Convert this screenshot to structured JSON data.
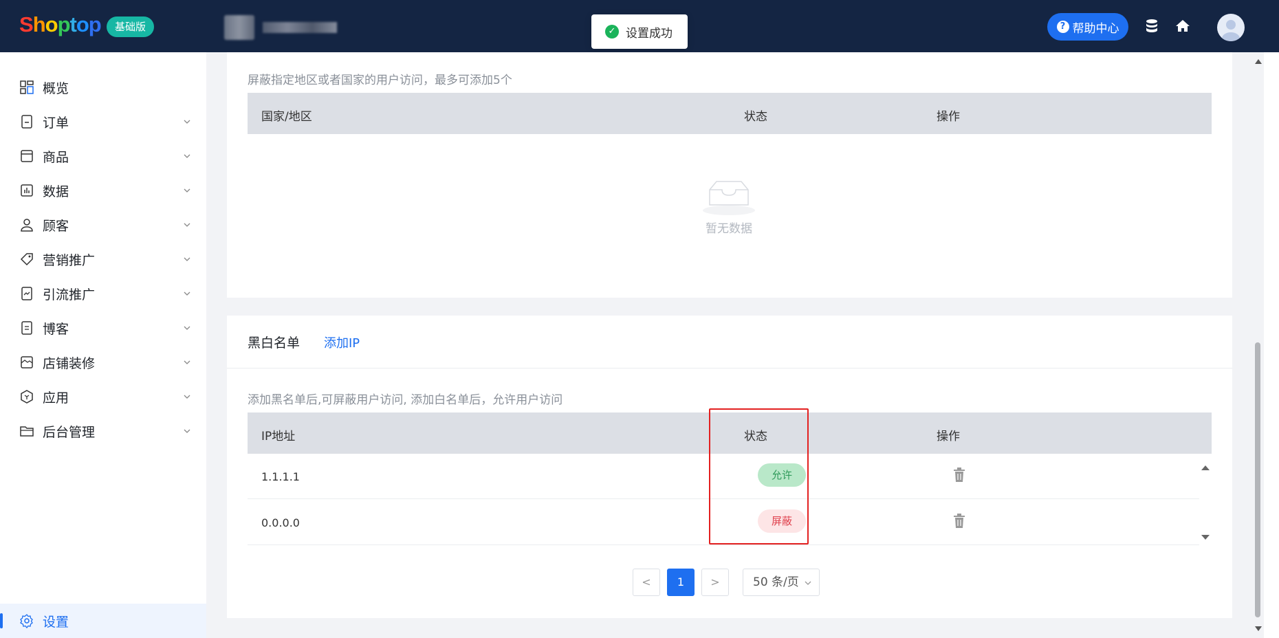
{
  "header": {
    "logo": "Shoptop",
    "plan_badge": "基础版",
    "toast": "设置成功",
    "help": "帮助中心"
  },
  "sidebar": {
    "items": [
      {
        "label": "概览"
      },
      {
        "label": "订单"
      },
      {
        "label": "商品"
      },
      {
        "label": "数据"
      },
      {
        "label": "顾客"
      },
      {
        "label": "营销推广"
      },
      {
        "label": "引流推广"
      },
      {
        "label": "博客"
      },
      {
        "label": "店铺装修"
      },
      {
        "label": "应用"
      },
      {
        "label": "后台管理"
      }
    ],
    "active": "设置"
  },
  "region_block": {
    "note": "屏蔽指定地区或者国家的用户访问，最多可添加5个",
    "columns": [
      "国家/地区",
      "状态",
      "操作"
    ],
    "empty": "暂无数据"
  },
  "blacklist": {
    "title": "黑白名单",
    "add_label": "添加IP",
    "note": "添加黑名单后,可屏蔽用户访问, 添加白名单后，允许用户访问",
    "columns": [
      "IP地址",
      "状态",
      "操作"
    ],
    "rows": [
      {
        "ip": "1.1.1.1",
        "status": "允许"
      },
      {
        "ip": "0.0.0.0",
        "status": "屏蔽"
      }
    ],
    "pager": {
      "prev": "<",
      "current": "1",
      "next": ">",
      "size": "50 条/页"
    }
  },
  "colors": {
    "primary": "#1e6ff0",
    "header": "#142543",
    "allow": "#2f9a5a",
    "block": "#e0434f",
    "highlight": "#e32020"
  }
}
